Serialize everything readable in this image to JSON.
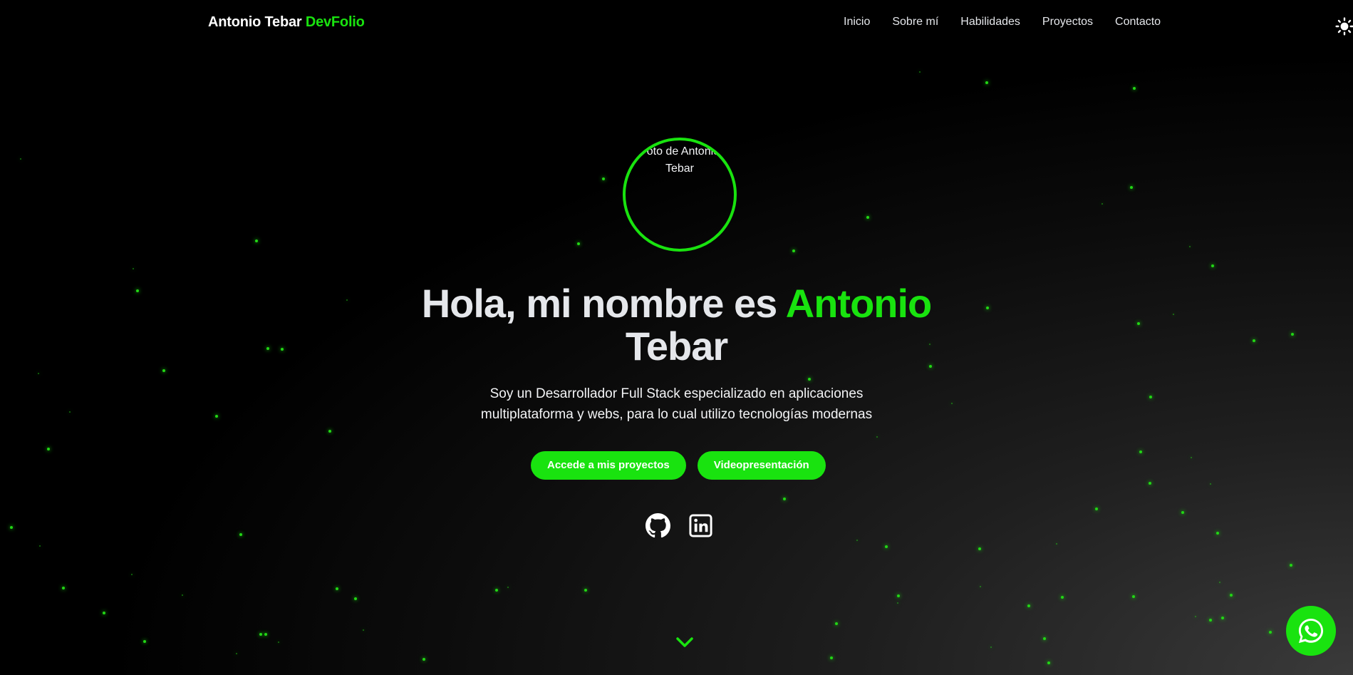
{
  "navbar": {
    "brand_name": "Antonio Tebar",
    "brand_accent": "DevFolio",
    "links": [
      "Inicio",
      "Sobre mí",
      "Habilidades",
      "Proyectos",
      "Contacto"
    ],
    "theme_toggle_icon": "sun-icon"
  },
  "hero": {
    "avatar_alt": "Foto de Antonio Tebar",
    "title_prefix": "Hola, mi nombre es",
    "title_accent": "Antonio",
    "title_suffix": "Tebar",
    "subtitle_line1": "Soy un Desarrollador Full Stack especializado en aplicaciones",
    "subtitle_line2": "multiplataforma y webs, para lo cual utilizo tecnologías modernas",
    "cta_projects": "Accede a mis proyectos",
    "cta_video": "Videopresentación",
    "social_icons": [
      "github-icon",
      "linkedin-icon"
    ],
    "scroll_icon": "chevron-down-icon"
  },
  "floating": {
    "whatsapp_icon": "whatsapp-icon"
  },
  "colors": {
    "accent": "#19e30f",
    "background": "#000000",
    "text": "#e5e7eb"
  }
}
